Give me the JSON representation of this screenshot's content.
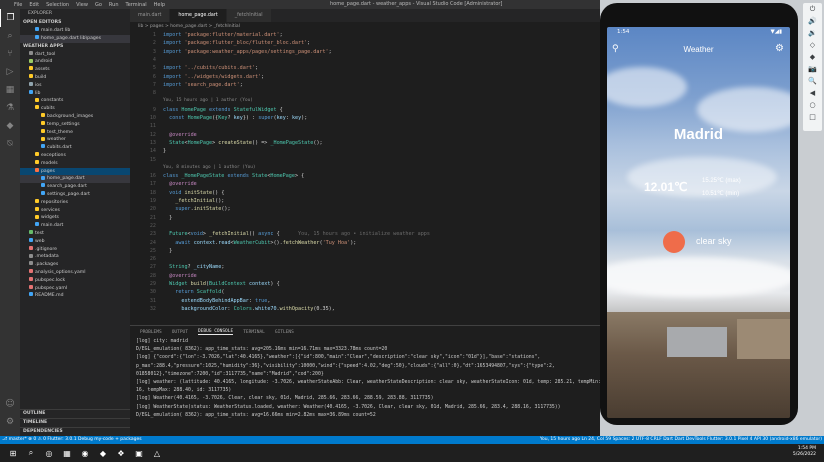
{
  "titlebar": {
    "menus": [
      "File",
      "Edit",
      "Selection",
      "View",
      "Go",
      "Run",
      "Terminal",
      "Help"
    ],
    "window_title": "home_page.dart - weather_apps - Visual Studio Code [Administrator]",
    "controls": [
      "–",
      "□",
      "✕"
    ]
  },
  "activity_icons": [
    "files-icon",
    "search-icon",
    "source-control-icon",
    "run-debug-icon",
    "extensions-icon",
    "testing-icon",
    "flutter-icon",
    "remote-icon"
  ],
  "sidebar": {
    "header": "EXPLORER",
    "open_editors_title": "OPEN EDITORS",
    "open_editors": [
      {
        "label": "main.dart lib",
        "color": "#42a5f5",
        "indent": 2
      },
      {
        "label": "home_page.dart lib\\pages",
        "color": "#42a5f5",
        "indent": 2,
        "state": "sel"
      }
    ],
    "workspace_title": "WEATHER APPS",
    "tree": [
      {
        "label": "dart_tool",
        "color": "#8d8d8d",
        "indent": 1
      },
      {
        "label": "android",
        "color": "#9ccc65",
        "indent": 1
      },
      {
        "label": "assets",
        "color": "#ffca28",
        "indent": 1
      },
      {
        "label": "build",
        "color": "#ffca28",
        "indent": 1
      },
      {
        "label": "ios",
        "color": "#90a4ae",
        "indent": 1
      },
      {
        "label": "lib",
        "color": "#42a5f5",
        "indent": 1
      },
      {
        "label": "constants",
        "color": "#ffca28",
        "indent": 2
      },
      {
        "label": "cubits",
        "color": "#ffca28",
        "indent": 2
      },
      {
        "label": "background_images",
        "color": "#ffca28",
        "indent": 3
      },
      {
        "label": "temp_settings",
        "color": "#ffca28",
        "indent": 3
      },
      {
        "label": "test_theme",
        "color": "#ffca28",
        "indent": 3
      },
      {
        "label": "weather",
        "color": "#ffca28",
        "indent": 3
      },
      {
        "label": "cubits.dart",
        "color": "#42a5f5",
        "indent": 3
      },
      {
        "label": "exceptions",
        "color": "#ffca28",
        "indent": 2
      },
      {
        "label": "models",
        "color": "#ffca28",
        "indent": 2
      },
      {
        "label": "pages",
        "color": "#ff7043",
        "indent": 2,
        "state": "hl"
      },
      {
        "label": "home_page.dart",
        "color": "#42a5f5",
        "indent": 3,
        "state": "sel"
      },
      {
        "label": "search_page.dart",
        "color": "#42a5f5",
        "indent": 3
      },
      {
        "label": "settings_page.dart",
        "color": "#42a5f5",
        "indent": 3
      },
      {
        "label": "repositories",
        "color": "#ffca28",
        "indent": 2
      },
      {
        "label": "services",
        "color": "#ffca28",
        "indent": 2
      },
      {
        "label": "widgets",
        "color": "#ffca28",
        "indent": 2
      },
      {
        "label": "main.dart",
        "color": "#42a5f5",
        "indent": 2
      },
      {
        "label": "test",
        "color": "#66bb6a",
        "indent": 1
      },
      {
        "label": "web",
        "color": "#42a5f5",
        "indent": 1
      },
      {
        "label": ".gitignore",
        "color": "#e57373",
        "indent": 1
      },
      {
        "label": ".metadata",
        "color": "#8d8d8d",
        "indent": 1
      },
      {
        "label": ".packages",
        "color": "#8d8d8d",
        "indent": 1
      },
      {
        "label": "analysis_options.yaml",
        "color": "#e57373",
        "indent": 1
      },
      {
        "label": "pubspec.lock",
        "color": "#e57373",
        "indent": 1
      },
      {
        "label": "pubspec.yaml",
        "color": "#e57373",
        "indent": 1
      },
      {
        "label": "README.md",
        "color": "#42a5f5",
        "indent": 1
      }
    ],
    "outline_title": "OUTLINE",
    "timeline_title": "TIMELINE",
    "dependencies_title": "DEPENDENCIES"
  },
  "tabs": [
    {
      "label": "main.dart",
      "active": false
    },
    {
      "label": "home_page.dart",
      "active": true
    },
    {
      "label": "_fetchInitial",
      "active": false
    }
  ],
  "breadcrumb": "lib > pages > home_page.dart > _fetchInitial",
  "code_lines": [
    {
      "n": "1",
      "t": "import 'package:flutter/material.dart';"
    },
    {
      "n": "2",
      "t": "import 'package:flutter_bloc/flutter_bloc.dart';"
    },
    {
      "n": "3",
      "t": "import 'package:weather_apps/pages/settings_page.dart';"
    },
    {
      "n": "4",
      "t": ""
    },
    {
      "n": "5",
      "t": "import '../cubits/cubits.dart';"
    },
    {
      "n": "6",
      "t": "import '../widgets/widgets.dart';"
    },
    {
      "n": "7",
      "t": "import 'search_page.dart';"
    },
    {
      "n": "8",
      "t": ""
    },
    {
      "n": "",
      "t": "You, 15 hours ago | 1 author (You)",
      "lens": true
    },
    {
      "n": "9",
      "t": "class HomePage extends StatefulWidget {"
    },
    {
      "n": "10",
      "t": "  const HomePage({Key? key}) : super(key: key);"
    },
    {
      "n": "11",
      "t": ""
    },
    {
      "n": "12",
      "t": "  @override"
    },
    {
      "n": "13",
      "t": "  State<HomePage> createState() => _HomePageState();"
    },
    {
      "n": "14",
      "t": "}"
    },
    {
      "n": "15",
      "t": ""
    },
    {
      "n": "",
      "t": "You, 8 minutes ago | 1 author (You)",
      "lens": true
    },
    {
      "n": "16",
      "t": "class _HomePageState extends State<HomePage> {"
    },
    {
      "n": "17",
      "t": "  @override"
    },
    {
      "n": "18",
      "t": "  void initState() {"
    },
    {
      "n": "19",
      "t": "    _fetchInitial();"
    },
    {
      "n": "20",
      "t": "    super.initState();"
    },
    {
      "n": "21",
      "t": "  }"
    },
    {
      "n": "22",
      "t": ""
    },
    {
      "n": "23",
      "t": "  Future<void> _fetchInitial() async {",
      "ghost": "      You, 15 hours ago • initialize weather apps"
    },
    {
      "n": "24",
      "t": "    await context.read<WeatherCubit>().fetchWeather('Tuy Hoa');"
    },
    {
      "n": "25",
      "t": "  }"
    },
    {
      "n": "26",
      "t": ""
    },
    {
      "n": "27",
      "t": "  String? _cityName;"
    },
    {
      "n": "28",
      "t": "  @override"
    },
    {
      "n": "29",
      "t": "  Widget build(BuildContext context) {"
    },
    {
      "n": "30",
      "t": "    return Scaffold("
    },
    {
      "n": "31",
      "t": "      extendBodyBehindAppBar: true,"
    },
    {
      "n": "32",
      "t": "      backgroundColor: Colors.white70.withOpacity(0.35),"
    }
  ],
  "panel": {
    "tabs": [
      {
        "label": "PROBLEMS",
        "active": false
      },
      {
        "label": "OUTPUT",
        "active": false
      },
      {
        "label": "DEBUG CONSOLE",
        "active": true
      },
      {
        "label": "TERMINAL",
        "active": false
      },
      {
        "label": "GITLENS",
        "active": false
      }
    ],
    "lines": [
      "[log] city: madrid",
      "D/EGL_emulation( 8362): app_time_stats: avg=205.16ms min=16.71ms max=3323.78ms count=20",
      "[log] {\"coord\":{\"lon\":-3.7026,\"lat\":40.4165},\"weather\":[{\"id\":800,\"main\":\"Clear\",\"description\":\"clear sky\",\"icon\":\"01d\"}],\"base\":\"stations\",",
      "p_max\":288.4,\"pressure\":1025,\"humidity\":36},\"visibility\":10000,\"wind\":{\"speed\":4.02,\"deg\":50},\"clouds\":{\"all\":0},\"dt\":1653494807,\"sys\":{\"type\":2,",
      "01858012},\"timezone\":7200,\"id\":3117735,\"name\":\"Madrid\",\"cod\":200}",
      "[log] weather: (lattitude: 40.4165, longitude: -3.7026, weatherStateAbb: Clear, weatherStateDescription: clear sky, weatherStateIcon: 01d, temp: 285.21, tempMin: 283.",
      "16, tempMax: 288.40, id: 3117735)",
      "[log] Weather(40.4165, -3.7026, Clear, clear sky, 01d, Madrid, 285.66, 283.66, 288.59, 283.88, 3117735)",
      "[log] WeatherState(status: WeatherStatus.loaded, weather: Weather(40.4165, -3.7026, Clear, clear sky, 01d, Madrid, 285.66, 283.4, 288.16, 3117735))",
      "D/EGL_emulation( 8362): app_time_stats: avg=16.66ms min=2.82ms max=36.89ms count=52"
    ]
  },
  "statusbar": {
    "left": "⎇ master*   ⊗ 0 ⚠ 0    Flutter: 3.0.1   Debug my-code + packages",
    "right": "You, 15 hours ago   Ln 24, Col 59   Spaces: 2   UTF-8   CRLF   Dart   Dart DevTools   Flutter: 3.0.1   Pixel 4 API 30 (android-x86 emulator)"
  },
  "phone": {
    "time": "1:54",
    "status_icons": "▼◢▮",
    "app_title": "Weather",
    "city": "Madrid",
    "temp": "12.01℃",
    "temp_max": "15.25℃ (max)",
    "temp_min": "10.51℃ (min)",
    "condition": "clear sky",
    "sun_color": "#ef6c4a"
  },
  "emulator_tools": [
    "⏻",
    "🔊",
    "🔉",
    "◇",
    "◆",
    "📷",
    "🔍",
    "◀",
    "○",
    "□"
  ],
  "taskbar": {
    "icons": [
      "⊞",
      "⌕",
      "◎",
      "▦",
      "◉",
      "◆",
      "❖",
      "▣",
      "△"
    ],
    "time": "1:54 PM",
    "date": "5/26/2022"
  }
}
